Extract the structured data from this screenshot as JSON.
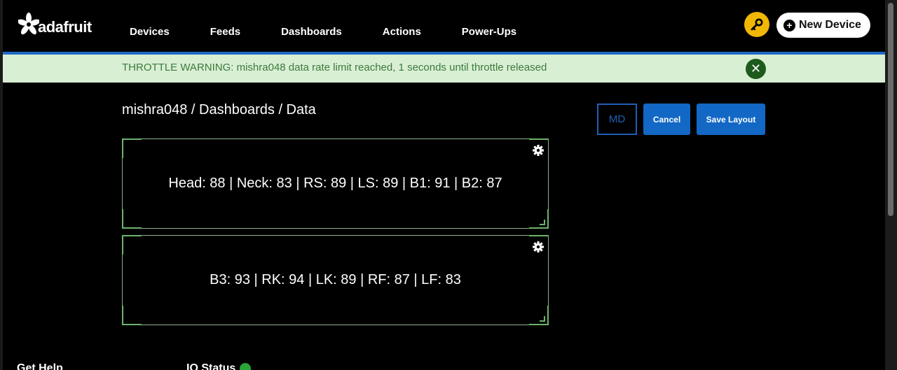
{
  "header": {
    "logo_text": "adafruit",
    "nav": [
      {
        "label": "Devices"
      },
      {
        "label": "Feeds"
      },
      {
        "label": "Dashboards"
      },
      {
        "label": "Actions"
      },
      {
        "label": "Power-Ups"
      }
    ],
    "new_device_label": "New Device"
  },
  "banner": {
    "text": "THROTTLE WARNING: mishra048 data rate limit reached, 1 seconds until throttle released"
  },
  "breadcrumb": "mishra048 / Dashboards / Data",
  "toolbar": {
    "md_label": "MD",
    "cancel_label": "Cancel",
    "save_label": "Save Layout"
  },
  "blocks": [
    {
      "text": "Head: 88 | Neck: 83 | RS: 89 | LS: 89 | B1: 91 | B2: 87"
    },
    {
      "text": "B3: 93 | RK: 94 | LK: 89 | RF: 87 | LF: 83"
    }
  ],
  "footer": {
    "help_label": "Get Help",
    "status_label": "IO Status"
  },
  "colors": {
    "accent_blue": "#1268c4",
    "banner_bg": "#d9efd4",
    "banner_text": "#3c7a3c",
    "key_yellow": "#f2b705",
    "status_green": "#2aa339"
  }
}
